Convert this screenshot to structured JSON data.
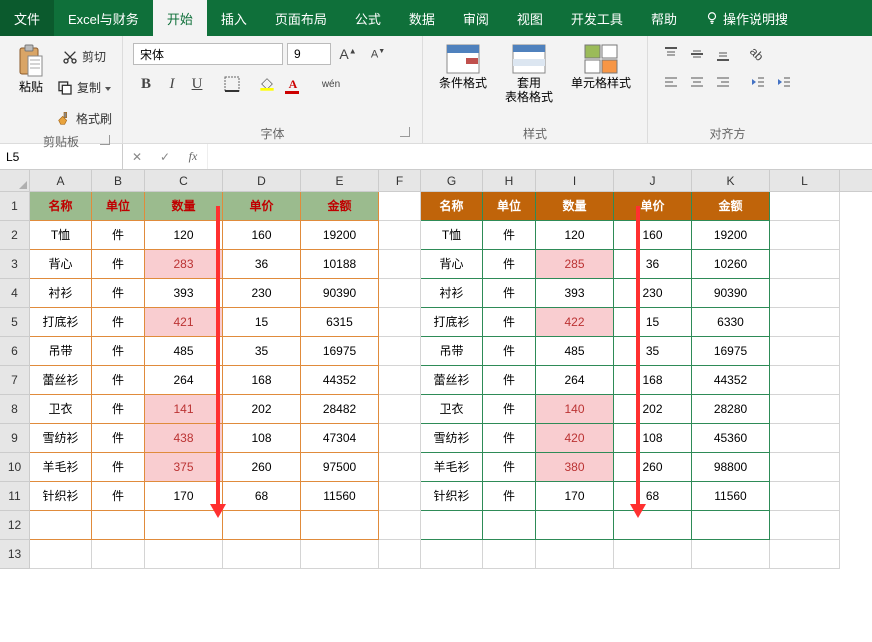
{
  "tabs": {
    "file": "文件",
    "excel": "Excel与财务",
    "home": "开始",
    "insert": "插入",
    "layout": "页面布局",
    "formula": "公式",
    "data": "数据",
    "review": "审阅",
    "view": "视图",
    "dev": "开发工具",
    "help": "帮助",
    "tell": "操作说明搜"
  },
  "ribbon": {
    "clipboard": {
      "paste": "粘贴",
      "cut": "剪切",
      "copy": "复制",
      "painter": "格式刷",
      "label": "剪贴板"
    },
    "font": {
      "name": "宋体",
      "size": "9",
      "wen": "wén",
      "label": "字体"
    },
    "styles": {
      "cond": "条件格式",
      "table": "套用\n表格格式",
      "cell": "单元格样式",
      "label": "样式"
    },
    "align": {
      "label": "对齐方"
    }
  },
  "namebox": "L5",
  "columns": [
    "A",
    "B",
    "C",
    "D",
    "E",
    "F",
    "G",
    "H",
    "I",
    "J",
    "K",
    "L"
  ],
  "header1": [
    "名称",
    "单位",
    "数量",
    "单价",
    "金额"
  ],
  "header2": [
    "名称",
    "单位",
    "数量",
    "单价",
    "金额"
  ],
  "table1": [
    [
      "T恤",
      "件",
      "120",
      "160",
      "19200"
    ],
    [
      "背心",
      "件",
      "283",
      "36",
      "10188"
    ],
    [
      "衬衫",
      "件",
      "393",
      "230",
      "90390"
    ],
    [
      "打底衫",
      "件",
      "421",
      "15",
      "6315"
    ],
    [
      "吊带",
      "件",
      "485",
      "35",
      "16975"
    ],
    [
      "蕾丝衫",
      "件",
      "264",
      "168",
      "44352"
    ],
    [
      "卫衣",
      "件",
      "141",
      "202",
      "28482"
    ],
    [
      "雪纺衫",
      "件",
      "438",
      "108",
      "47304"
    ],
    [
      "羊毛衫",
      "件",
      "375",
      "260",
      "97500"
    ],
    [
      "针织衫",
      "件",
      "170",
      "68",
      "11560"
    ]
  ],
  "table2": [
    [
      "T恤",
      "件",
      "120",
      "160",
      "19200"
    ],
    [
      "背心",
      "件",
      "285",
      "36",
      "10260"
    ],
    [
      "衬衫",
      "件",
      "393",
      "230",
      "90390"
    ],
    [
      "打底衫",
      "件",
      "422",
      "15",
      "6330"
    ],
    [
      "吊带",
      "件",
      "485",
      "35",
      "16975"
    ],
    [
      "蕾丝衫",
      "件",
      "264",
      "168",
      "44352"
    ],
    [
      "卫衣",
      "件",
      "140",
      "202",
      "28280"
    ],
    [
      "雪纺衫",
      "件",
      "420",
      "108",
      "45360"
    ],
    [
      "羊毛衫",
      "件",
      "380",
      "260",
      "98800"
    ],
    [
      "针织衫",
      "件",
      "170",
      "68",
      "11560"
    ]
  ],
  "highlight1": [
    1,
    3,
    6,
    7,
    8
  ],
  "highlight2": [
    1,
    3,
    6,
    7,
    8
  ],
  "chart_data": {
    "type": "table",
    "tables": [
      {
        "name": "left",
        "headers": [
          "名称",
          "单位",
          "数量",
          "单价",
          "金额"
        ],
        "rows": [
          [
            "T恤",
            "件",
            120,
            160,
            19200
          ],
          [
            "背心",
            "件",
            283,
            36,
            10188
          ],
          [
            "衬衫",
            "件",
            393,
            230,
            90390
          ],
          [
            "打底衫",
            "件",
            421,
            15,
            6315
          ],
          [
            "吊带",
            "件",
            485,
            35,
            16975
          ],
          [
            "蕾丝衫",
            "件",
            264,
            168,
            44352
          ],
          [
            "卫衣",
            "件",
            141,
            202,
            28482
          ],
          [
            "雪纺衫",
            "件",
            438,
            108,
            47304
          ],
          [
            "羊毛衫",
            "件",
            375,
            260,
            97500
          ],
          [
            "针织衫",
            "件",
            170,
            68,
            11560
          ]
        ]
      },
      {
        "name": "right",
        "headers": [
          "名称",
          "单位",
          "数量",
          "单价",
          "金额"
        ],
        "rows": [
          [
            "T恤",
            "件",
            120,
            160,
            19200
          ],
          [
            "背心",
            "件",
            285,
            36,
            10260
          ],
          [
            "衬衫",
            "件",
            393,
            230,
            90390
          ],
          [
            "打底衫",
            "件",
            422,
            15,
            6330
          ],
          [
            "吊带",
            "件",
            485,
            35,
            16975
          ],
          [
            "蕾丝衫",
            "件",
            264,
            168,
            44352
          ],
          [
            "卫衣",
            "件",
            140,
            202,
            28280
          ],
          [
            "雪纺衫",
            "件",
            420,
            108,
            45360
          ],
          [
            "羊毛衫",
            "件",
            380,
            260,
            98800
          ],
          [
            "针织衫",
            "件",
            170,
            68,
            11560
          ]
        ]
      }
    ]
  }
}
